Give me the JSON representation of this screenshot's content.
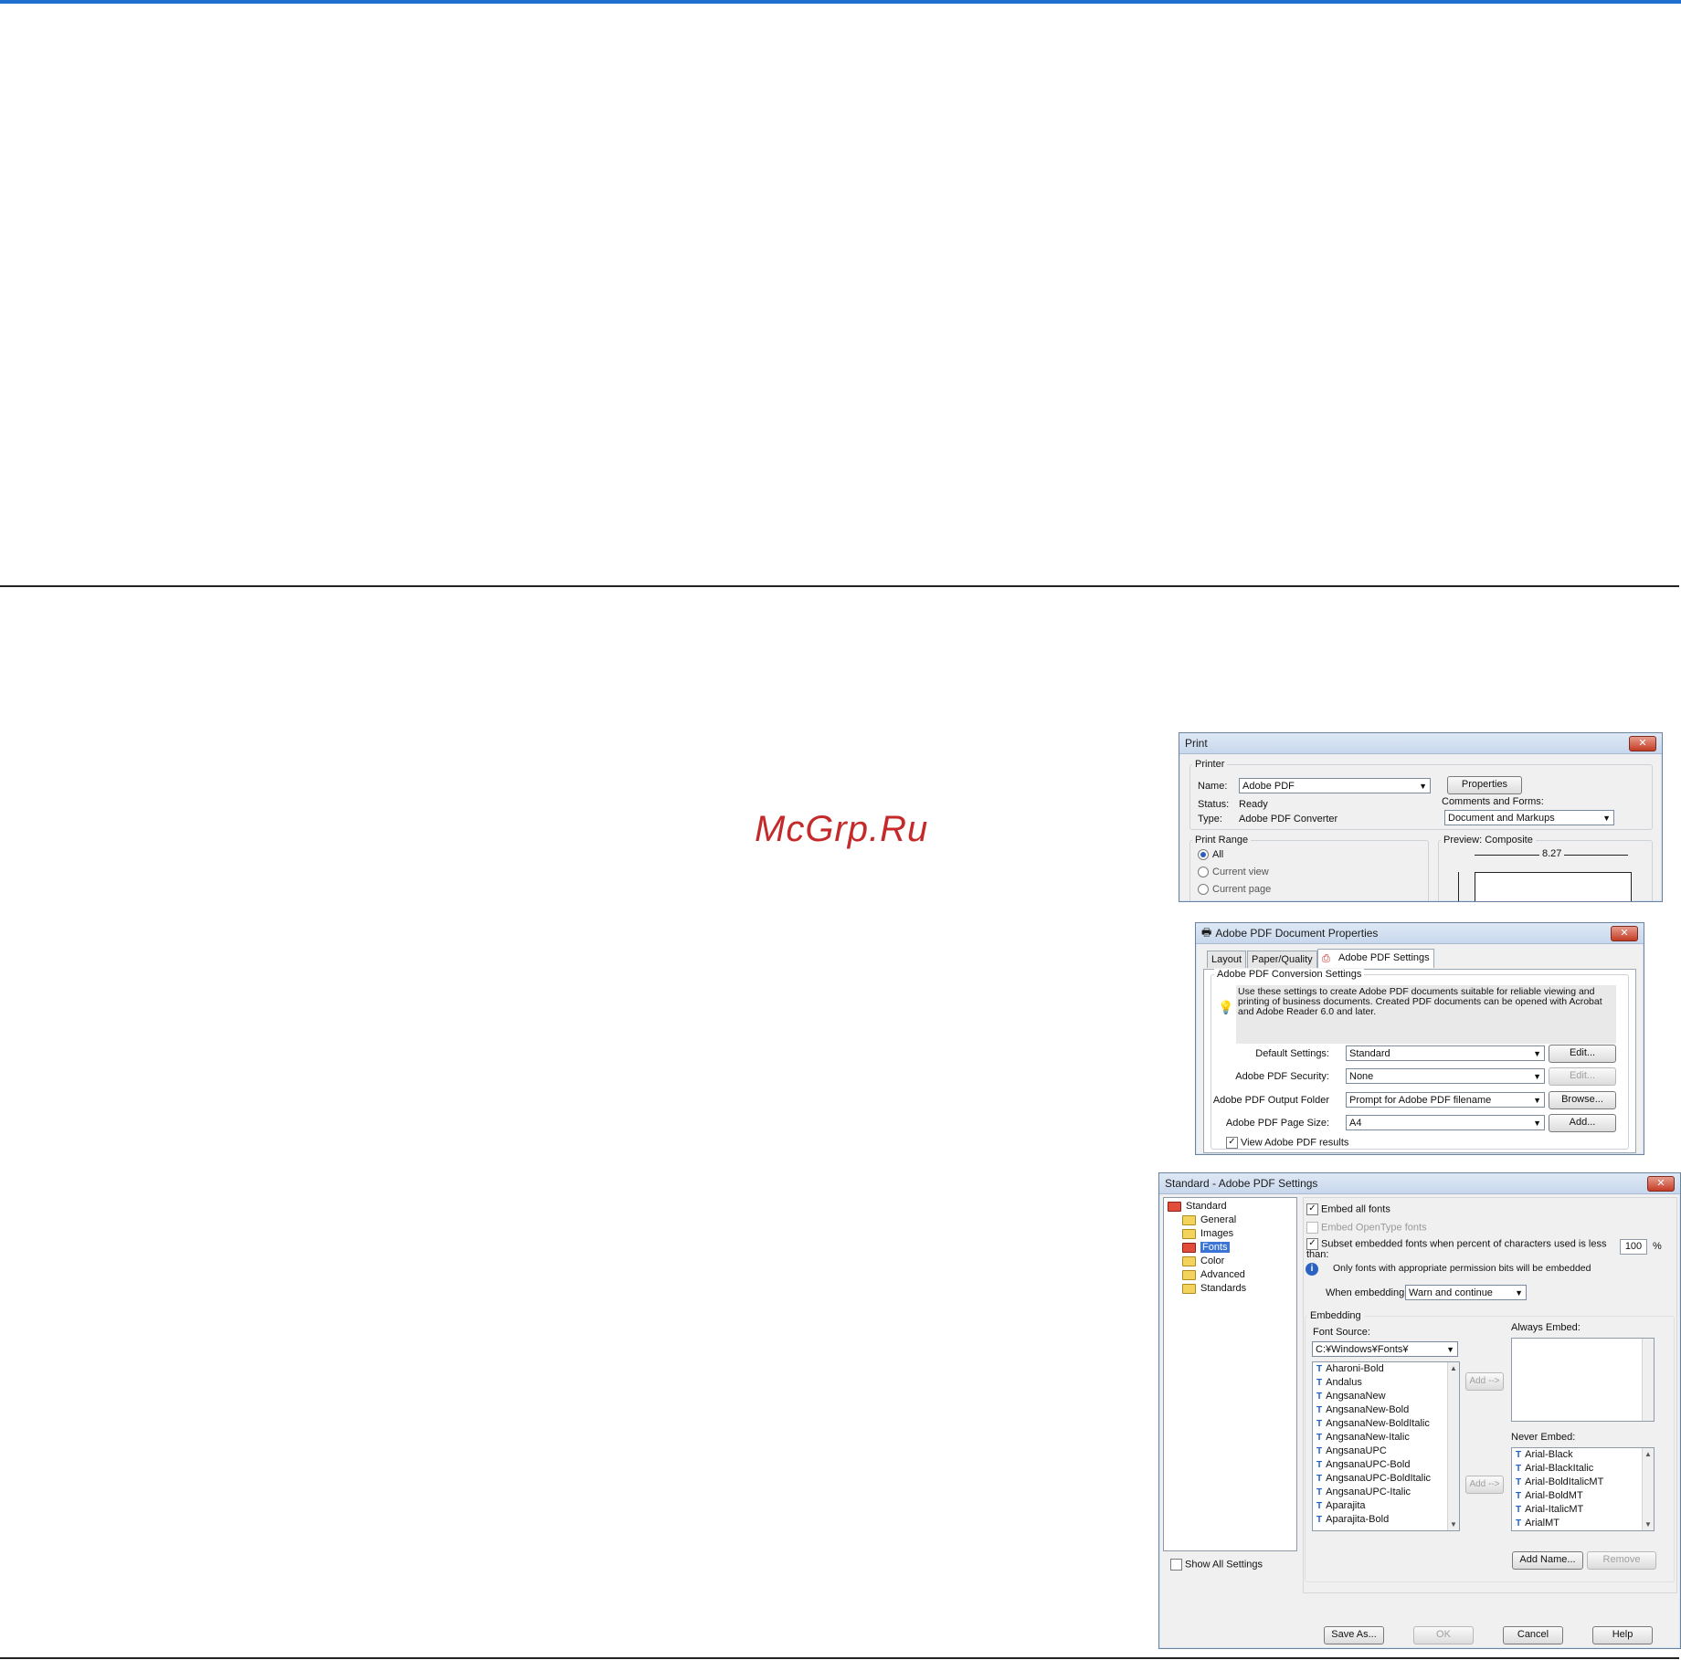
{
  "watermark": "McGrp.Ru",
  "print_dialog": {
    "title": "Print",
    "close": "✕",
    "printer_group": "Printer",
    "name_label": "Name:",
    "name_value": "Adobe PDF",
    "properties_button": "Properties",
    "status_label": "Status:",
    "status_value": "Ready",
    "type_label": "Type:",
    "type_value": "Adobe PDF Converter",
    "comments_label": "Comments and Forms:",
    "comments_value": "Document and Markups",
    "print_range_group": "Print Range",
    "range_all": "All",
    "range_current_view": "Current view",
    "range_current_page": "Current page",
    "preview_label": "Preview: Composite",
    "preview_width": "8.27"
  },
  "doc_properties": {
    "title": "Adobe PDF Document Properties",
    "close": "✕",
    "tabs": [
      "Layout",
      "Paper/Quality",
      "Adobe PDF Settings"
    ],
    "group_title": "Adobe PDF Conversion Settings",
    "description": "Use these settings to create Adobe PDF documents suitable for reliable viewing and printing of business documents. Created PDF documents can be opened with Acrobat and Adobe Reader 6.0 and later.",
    "default_settings_label": "Default Settings:",
    "default_settings_value": "Standard",
    "edit_button": "Edit...",
    "security_label": "Adobe PDF Security:",
    "security_value": "None",
    "edit_disabled_button": "Edit...",
    "output_folder_label": "Adobe PDF Output Folder",
    "output_folder_value": "Prompt for Adobe PDF filename",
    "browse_button": "Browse...",
    "page_size_label": "Adobe PDF Page Size:",
    "page_size_value": "A4",
    "add_button": "Add...",
    "view_results_label": "View Adobe PDF results"
  },
  "pdf_settings": {
    "title": "Standard - Adobe PDF Settings",
    "close": "✕",
    "tree": [
      "Standard",
      "General",
      "Images",
      "Fonts",
      "Color",
      "Advanced",
      "Standards"
    ],
    "embed_all_fonts": "Embed all fonts",
    "embed_opentype": "Embed OpenType fonts",
    "subset_label": "Subset embedded fonts when percent of characters used is less than:",
    "subset_value": "100",
    "subset_unit": "%",
    "info_text": "Only fonts with appropriate permission bits will be embedded",
    "when_embedding_label": "When embedding",
    "when_embedding_value": "Warn and continue",
    "embedding_group": "Embedding",
    "font_source_label": "Font Source:",
    "font_source_value": "C:¥Windows¥Fonts¥",
    "font_list": [
      "Aharoni-Bold",
      "Andalus",
      "AngsanaNew",
      "AngsanaNew-Bold",
      "AngsanaNew-BoldItalic",
      "AngsanaNew-Italic",
      "AngsanaUPC",
      "AngsanaUPC-Bold",
      "AngsanaUPC-BoldItalic",
      "AngsanaUPC-Italic",
      "Aparajita",
      "Aparajita-Bold"
    ],
    "add_button_1": "Add -->",
    "add_button_2": "Add -->",
    "always_embed_label": "Always Embed:",
    "never_embed_label": "Never Embed:",
    "never_embed_list": [
      "Arial-Black",
      "Arial-BlackItalic",
      "Arial-BoldItalicMT",
      "Arial-BoldMT",
      "Arial-ItalicMT",
      "ArialMT"
    ],
    "add_name_button": "Add Name...",
    "remove_button": "Remove",
    "show_all_label": "Show All Settings",
    "save_as_button": "Save As...",
    "ok_button": "OK",
    "cancel_button": "Cancel",
    "help_button": "Help"
  }
}
